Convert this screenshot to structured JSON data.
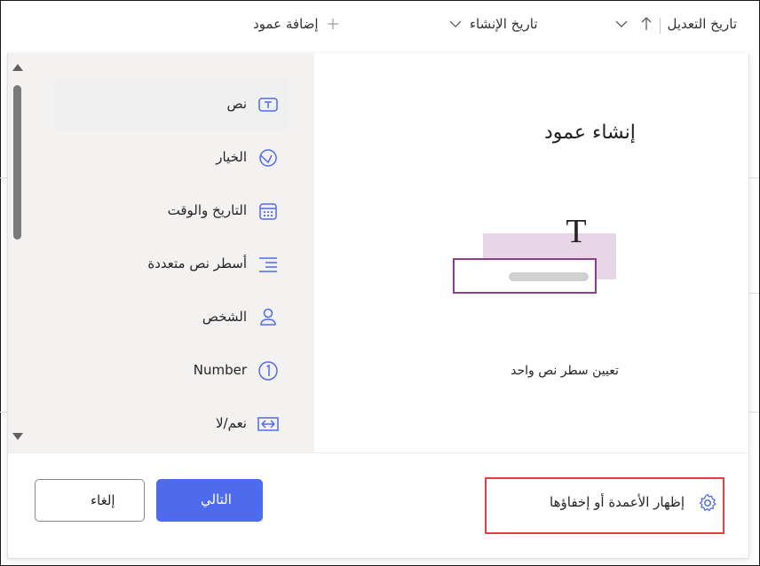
{
  "header": {
    "modified_label": "تاريخ التعديل",
    "created_label": "تاريخ الإنشاء",
    "add_column_label": "إضافة عمود"
  },
  "dialog": {
    "title": "إنشاء عمود",
    "preview_description": "تعيين سطر نص واحد",
    "preview_glyph": "T",
    "column_types": [
      {
        "label": "نص",
        "icon": "text-box-icon",
        "selected": true
      },
      {
        "label": "الخيار",
        "icon": "choice-icon",
        "selected": false
      },
      {
        "label": "التاريخ والوقت",
        "icon": "calendar-icon",
        "selected": false
      },
      {
        "label": "أسطر نص متعددة",
        "icon": "multiline-text-icon",
        "selected": false
      },
      {
        "label": "الشخص",
        "icon": "person-icon",
        "selected": false
      },
      {
        "label": "Number",
        "icon": "number-icon",
        "selected": false
      },
      {
        "label": "نعم/لا",
        "icon": "yes-no-icon",
        "selected": false
      }
    ],
    "footer": {
      "show_hide_label": "إظهار الأعمدة أو إخفاؤها",
      "next_label": "التالي",
      "cancel_label": "إلغاء"
    }
  },
  "colors": {
    "accent": "#4f6bed",
    "highlight": "#e04148",
    "preview_purple": "#8b3f8b",
    "preview_fill": "#e6d6e6"
  }
}
